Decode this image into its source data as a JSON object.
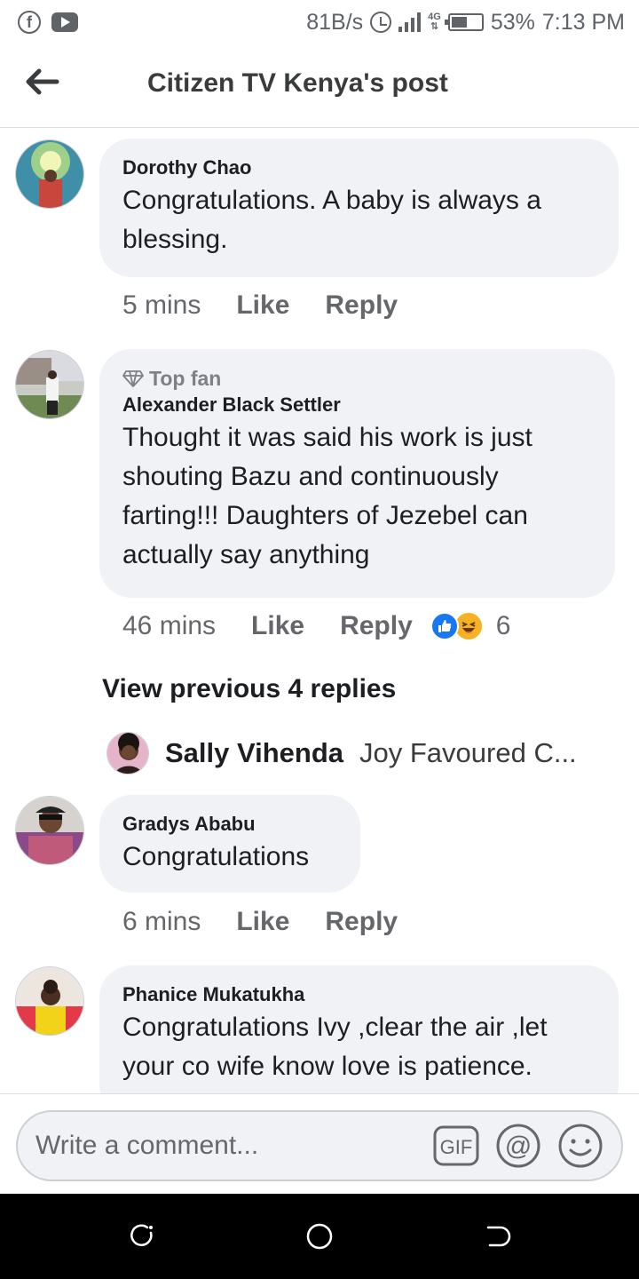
{
  "status_bar": {
    "left_icons": [
      "facebook-icon",
      "youtube-icon"
    ],
    "speed": "81B/s",
    "network": "4G",
    "battery_percent": "53%",
    "battery_level": 0.53,
    "time": "7:13 PM"
  },
  "header": {
    "title": "Citizen TV Kenya's post",
    "back_icon": "arrow-left-icon"
  },
  "comments": [
    {
      "author": "Dorothy Chao",
      "text": "Congratulations. A baby is always a blessing.",
      "time": "5 mins",
      "like_label": "Like",
      "reply_label": "Reply"
    },
    {
      "badge": "Top fan",
      "badge_icon": "diamond-icon",
      "author": "Alexander Black Settler",
      "text": "Thought it was said his work is just shouting Bazu and continuously farting!!! Daughters of Jezebel can actually say anything",
      "time": "46 mins",
      "like_label": "Like",
      "reply_label": "Reply",
      "reactions": [
        "like",
        "haha"
      ],
      "reaction_count": "6",
      "view_previous": "View previous 4 replies",
      "reply_preview": {
        "author": "Sally Vihenda",
        "text": "Joy Favoured C..."
      }
    },
    {
      "author": "Gradys Ababu",
      "text": "Congratulations",
      "time": "6 mins",
      "like_label": "Like",
      "reply_label": "Reply"
    },
    {
      "author": "Phanice Mukatukha",
      "text": "Congratulations Ivy ,clear the air ,let your co wife know love is patience."
    }
  ],
  "composer": {
    "placeholder": "Write a comment...",
    "icons": [
      "gif-icon",
      "mention-icon",
      "emoji-icon"
    ],
    "gif_label": "GIF",
    "mention_label": "@"
  },
  "colors": {
    "bubble": "#f0f2f5",
    "like_blue": "#1877f2",
    "haha_yellow": "#f7b125",
    "muted_text": "#65676b"
  }
}
